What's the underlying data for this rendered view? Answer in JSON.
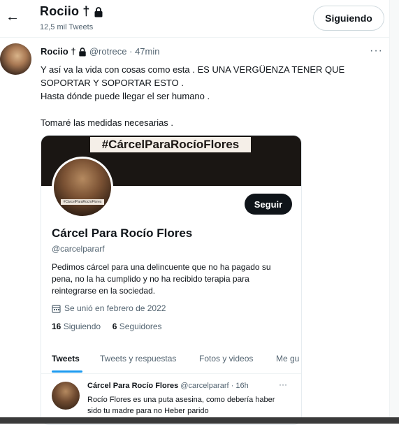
{
  "header": {
    "back_icon": "arrow-left-icon",
    "name": "Rociio",
    "name_glyph": "†",
    "lock_icon": "lock-icon",
    "tweet_count": "12,5 mil Tweets",
    "follow_label": "Siguiendo"
  },
  "tweet": {
    "author": "Rociio †",
    "handle": "@rotrece",
    "time": "· 47min",
    "more": "···",
    "lines": [
      "Y así va la vida con cosas como esta . ES UNA VERGÜENZA TENER QUE SOPORTAR Y SOPORTAR ESTO .",
      "Hasta dónde puede llegar el ser humano .",
      "",
      "Tomaré las medidas necesarias ."
    ]
  },
  "card": {
    "banner_text": "#CárcelParaRocíoFlores",
    "avatar_caption": "#CárcelParaRocíoFlores",
    "follow_label": "Seguir",
    "name": "Cárcel Para Rocío Flores",
    "handle": "@carcelpararf",
    "bio": "Pedimos cárcel para una delincuente que no ha pagado su pena, no la ha cumplido y no ha recibido terapia para reintegrarse en la sociedad.",
    "joined": "Se unió en febrero de 2022",
    "calendar_icon": "calendar-icon",
    "following_count": "16",
    "following_label": "Siguiendo",
    "followers_count": "6",
    "followers_label": "Seguidores",
    "tabs": [
      "Tweets",
      "Tweets y respuestas",
      "Fotos y videos",
      "Me gu"
    ],
    "inner_tweet": {
      "author": "Cárcel Para Rocío Flores",
      "handle": "@carcelpararf",
      "time": "· 16h",
      "more": "···",
      "text": "Rocío Flores es una puta asesina, como debería haber sido tu madre para no Heber parido"
    }
  },
  "colors": {
    "accent": "#1d9bf0",
    "text": "#0f1419",
    "muted": "#536471",
    "banner": "#1a1613"
  }
}
